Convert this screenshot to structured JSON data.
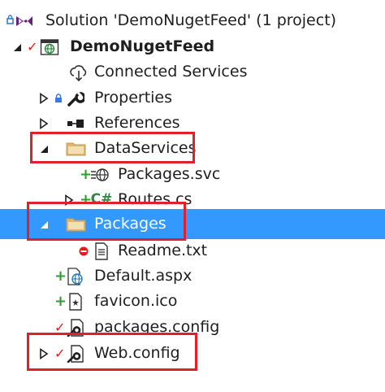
{
  "tree": {
    "solution_label": "Solution 'DemoNugetFeed' (1 project)",
    "project_label": "DemoNugetFeed",
    "connected_services_label": "Connected Services",
    "properties_label": "Properties",
    "references_label": "References",
    "dataservices_label": "DataServices",
    "packages_svc_label": "Packages.svc",
    "routes_label": "Routes.cs",
    "packages_folder_label": "Packages",
    "readme_label": "Readme.txt",
    "default_label": "Default.aspx",
    "favicon_label": "favicon.ico",
    "packages_config_label": "packages.config",
    "webconfig_label": "Web.config"
  },
  "colors": {
    "selection": "#3399ff",
    "highlight_border": "#e0202a",
    "folder": "#dcb67a",
    "add_status": "#2e9e2e",
    "checked_out": "#e21c1c"
  }
}
